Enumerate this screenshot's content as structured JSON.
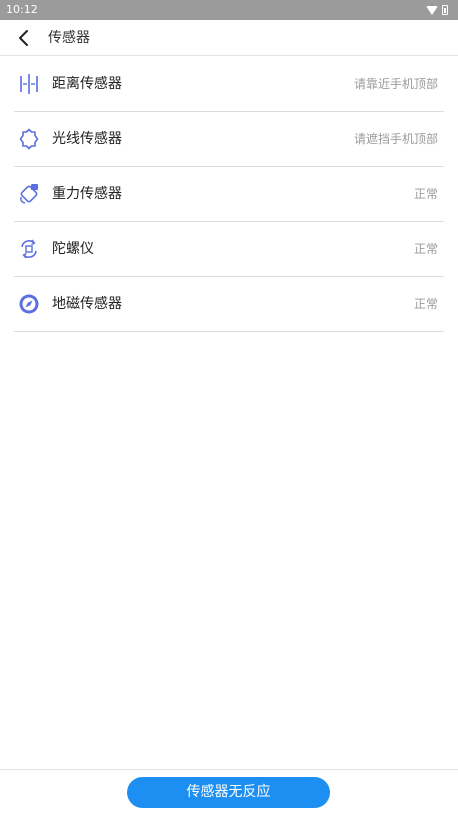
{
  "status_bar": {
    "time": "10:12",
    "icons": [
      "wifi-icon",
      "battery-icon"
    ]
  },
  "header": {
    "title": "传感器",
    "back_icon": "chevron-left-icon"
  },
  "sensors": [
    {
      "label": "距离传感器",
      "status": "请靠近手机顶部",
      "icon": "proximity-icon"
    },
    {
      "label": "光线传感器",
      "status": "请遮挡手机顶部",
      "icon": "light-icon"
    },
    {
      "label": "重力传感器",
      "status": "正常",
      "icon": "gravity-icon"
    },
    {
      "label": "陀螺仪",
      "status": "正常",
      "icon": "gyroscope-icon"
    },
    {
      "label": "地磁传感器",
      "status": "正常",
      "icon": "compass-icon"
    }
  ],
  "bottom": {
    "button_label": "传感器无反应"
  },
  "colors": {
    "accent": "#1e8ff2",
    "icon": "#5b6fe0",
    "status_bar": "#9b9b9b",
    "status_text": "#9a9a9a",
    "divider": "#dcdcdc"
  }
}
